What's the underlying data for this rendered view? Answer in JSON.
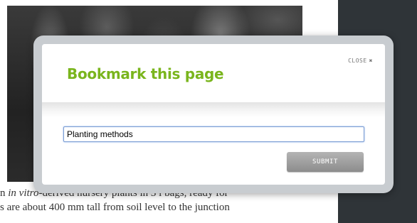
{
  "background": {
    "text_lines": [
      {
        "prefix": "n ",
        "italic": "in vitro",
        "suffix": "-derived nursery plants in 3 l bags, ready for"
      },
      {
        "prefix": "s are about 400 mm tall from soil level to the junction",
        "italic": "",
        "suffix": ""
      }
    ]
  },
  "modal": {
    "title": "Bookmark this page",
    "close_label": "CLOSE",
    "close_glyph": "✖",
    "input_value": "Planting methods",
    "submit_label": "SUBMIT"
  },
  "colors": {
    "title_green": "#7ab51d",
    "sidebar": "#2f3438",
    "button_gray": "#9a9a9a"
  }
}
